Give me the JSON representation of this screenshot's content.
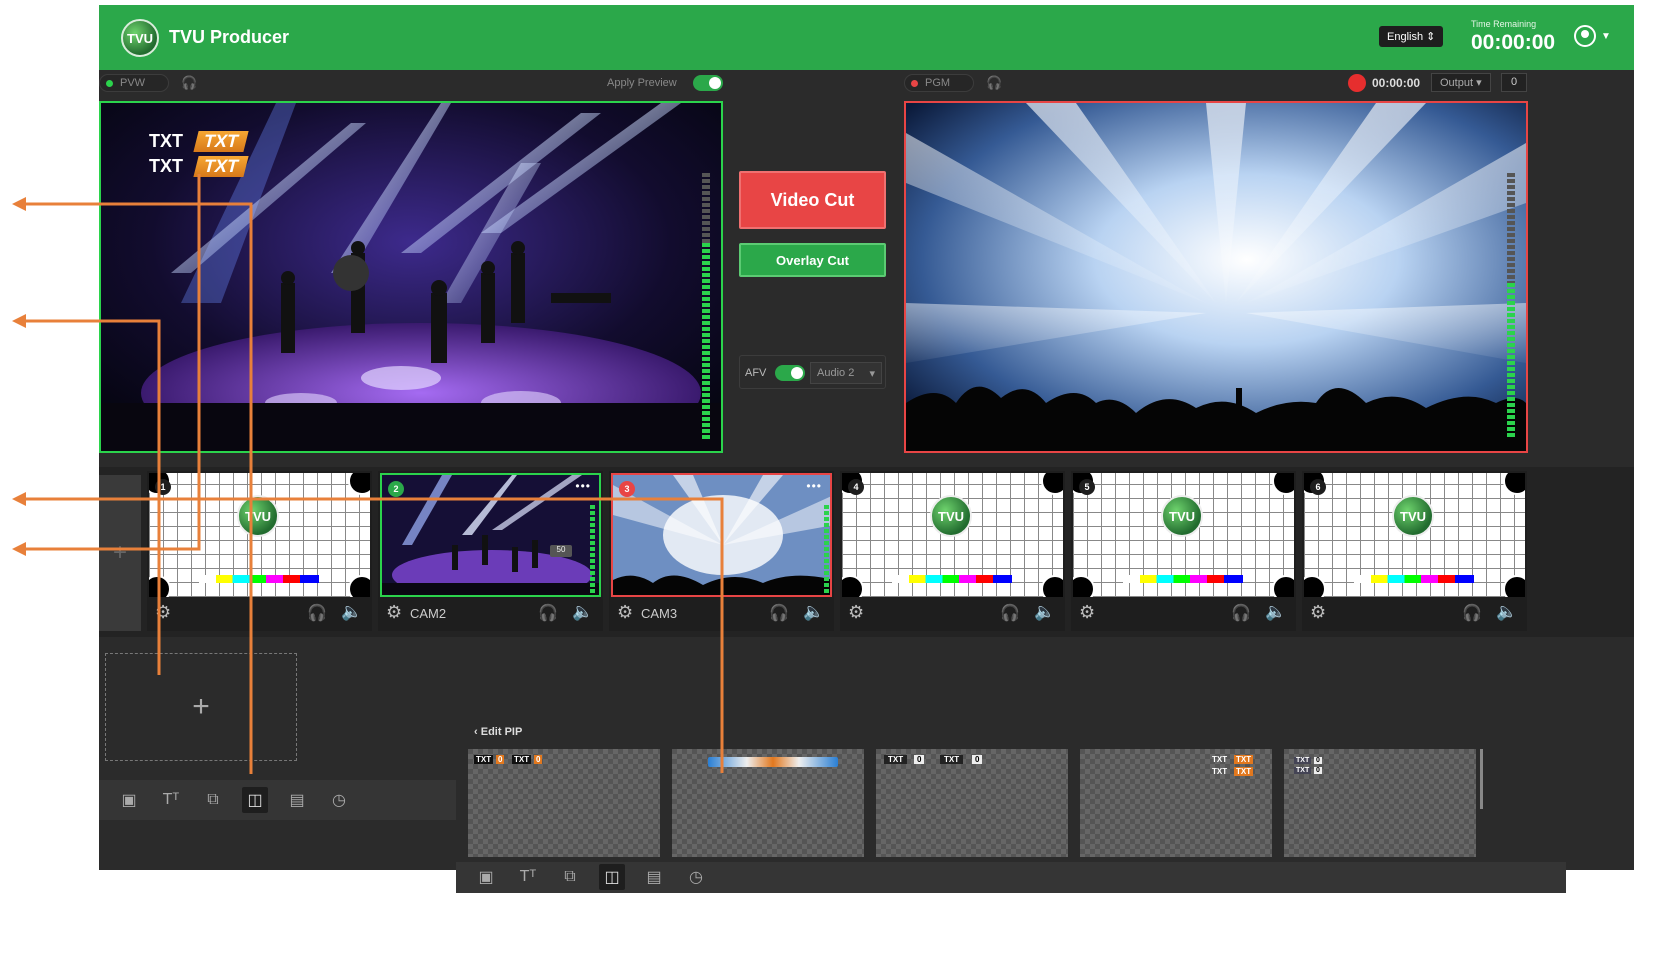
{
  "header": {
    "app_title": "TVU Producer",
    "logo_text": "TVU",
    "language": "English",
    "time_remaining_label": "Time Remaining",
    "time_remaining_value": "00:00:00"
  },
  "preview": {
    "label": "PVW",
    "apply_preview_label": "Apply Preview",
    "overlay_rows": [
      {
        "left": "TXT",
        "right": "TXT"
      },
      {
        "left": "TXT",
        "right": "TXT"
      }
    ]
  },
  "program": {
    "label": "PGM",
    "record_time": "00:00:00",
    "output_label": "Output",
    "output_count": "0"
  },
  "controls": {
    "video_cut": "Video Cut",
    "overlay_cut": "Overlay Cut",
    "afv_label": "AFV",
    "audio_select": "Audio 2"
  },
  "sources": [
    {
      "num": "1",
      "name": "",
      "type": "testpattern",
      "color": "#1e1e1e"
    },
    {
      "num": "2",
      "name": "CAM2",
      "type": "concert",
      "color": "#2ba84a",
      "badge": "50"
    },
    {
      "num": "3",
      "name": "CAM3",
      "type": "lights",
      "color": "#e84545"
    },
    {
      "num": "4",
      "name": "",
      "type": "testpattern",
      "color": "#1e1e1e"
    },
    {
      "num": "5",
      "name": "",
      "type": "testpattern",
      "color": "#1e1e1e"
    },
    {
      "num": "6",
      "name": "",
      "type": "testpattern",
      "color": "#1e1e1e"
    }
  ],
  "pip": {
    "header": "Edit PIP",
    "tiles": [
      {
        "t1": "TXT",
        "v1": "0",
        "t2": "TXT",
        "v2": "0"
      },
      {
        "t1": "",
        "v1": "",
        "t2": "",
        "v2": ""
      },
      {
        "t1": "TXT",
        "v1": "0",
        "t2": "TXT",
        "v2": "0"
      },
      {
        "t1": "TXT",
        "v1": "TXT",
        "t2": "TXT",
        "v2": "TXT"
      },
      {
        "t1": "TXT",
        "v1": "0",
        "t2": "TXT",
        "v2": "0"
      }
    ]
  },
  "toolbar_icons": [
    "image-icon",
    "text-icon",
    "layers-icon",
    "pip-icon",
    "film-icon",
    "clock-icon"
  ],
  "colors": {
    "brand_green": "#2ba84a",
    "cut_red": "#e84545",
    "annotation_orange": "#e8803a",
    "app_bg": "#2b2b2b"
  }
}
